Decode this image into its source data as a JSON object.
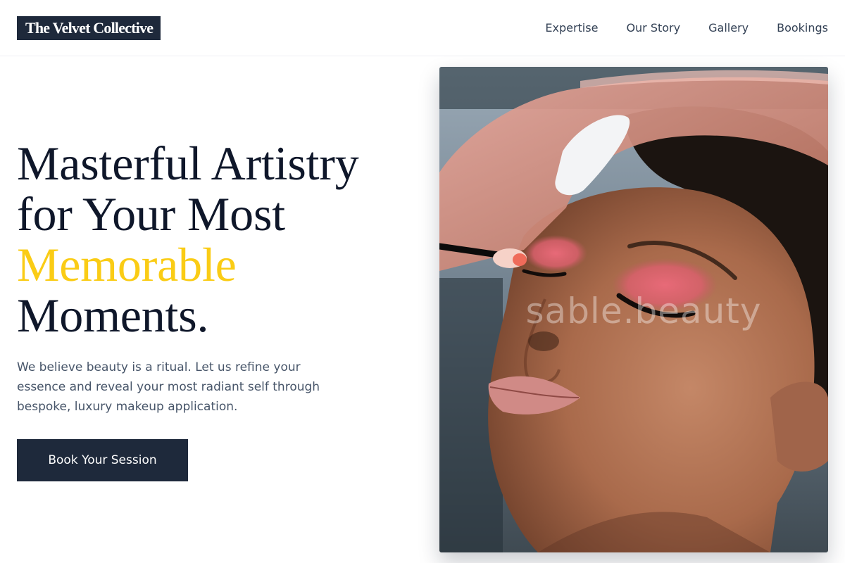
{
  "header": {
    "logo": "The Velvet Collective",
    "nav": [
      "Expertise",
      "Our Story",
      "Gallery",
      "Bookings"
    ]
  },
  "hero": {
    "headline_line1": "Masterful Artistry",
    "headline_line2": "for Your Most",
    "headline_accent": "Memorable",
    "headline_line4": "Moments.",
    "lead": "We believe beauty is a ritual. Let us refine your essence and reveal your most radiant self through bespoke, luxury makeup application.",
    "cta": "Book Your Session"
  },
  "image": {
    "watermark": "sable.beauty"
  },
  "colors": {
    "accent": "#facc15",
    "navy": "#1e293b",
    "heading": "#0f172a",
    "body_text": "#475569"
  }
}
